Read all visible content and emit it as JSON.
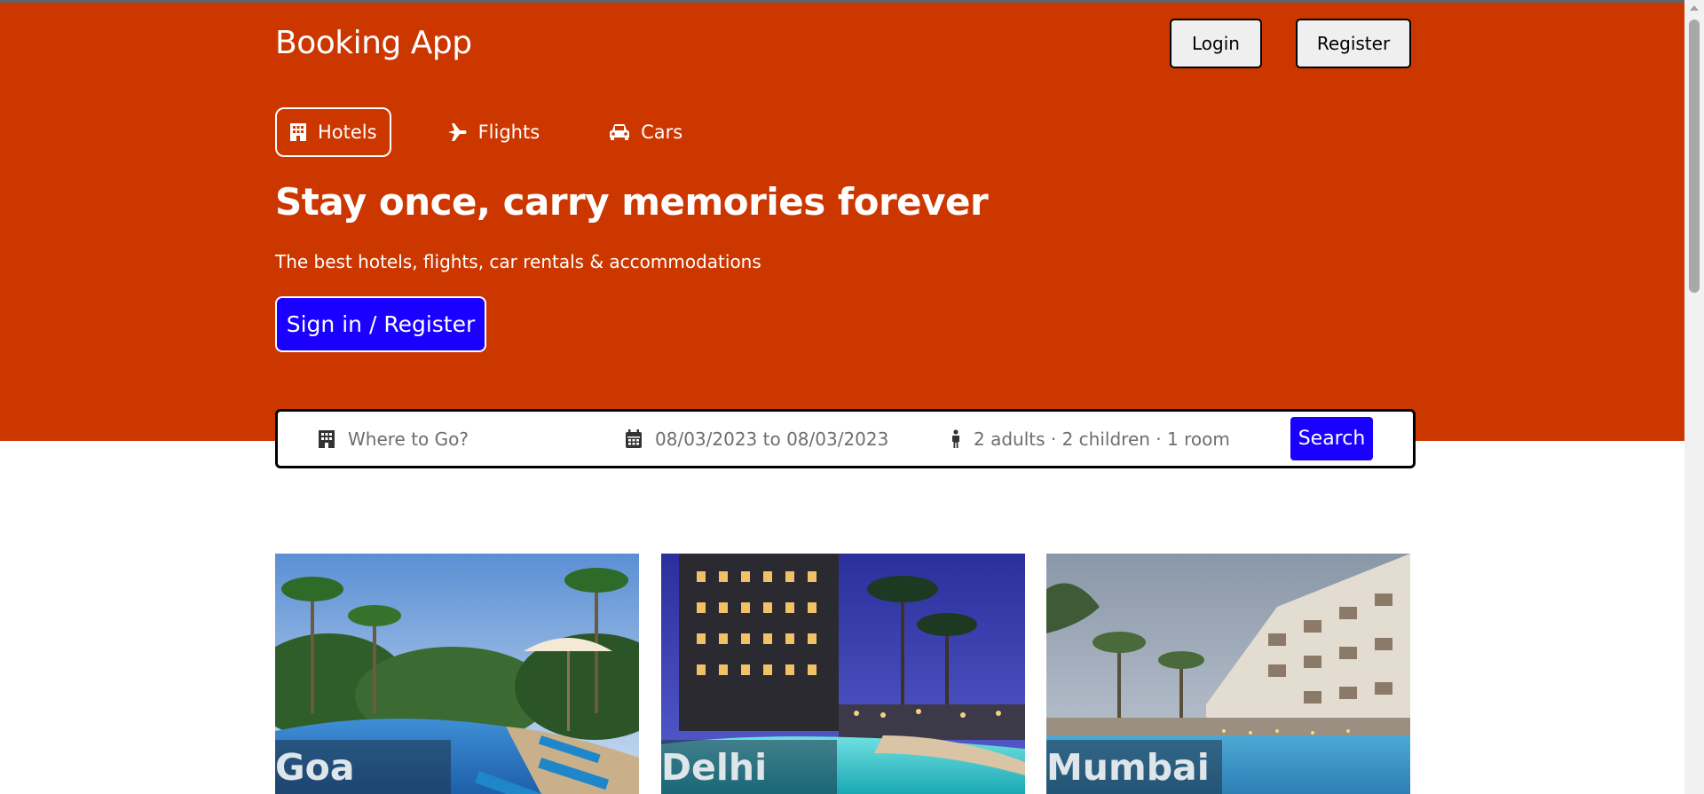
{
  "header": {
    "brand": "Booking App",
    "login_label": "Login",
    "register_label": "Register"
  },
  "tabs": [
    {
      "label": "Hotels",
      "icon": "hotel-icon",
      "active": true
    },
    {
      "label": "Flights",
      "icon": "plane-icon",
      "active": false
    },
    {
      "label": "Cars",
      "icon": "car-icon",
      "active": false
    }
  ],
  "hero": {
    "headline": "Stay once, carry memories forever",
    "subline": "The best hotels, flights, car rentals & accommodations",
    "cta_label": "Sign in / Register",
    "background_color": "#cc3700",
    "accent_color": "#1a00ff"
  },
  "search": {
    "destination_placeholder": "Where to Go?",
    "dates_value": "08/03/2023 to 08/03/2023",
    "guests_value": "2 adults · 2 children · 1 room",
    "button_label": "Search"
  },
  "destinations": [
    {
      "name": "Goa"
    },
    {
      "name": "Delhi"
    },
    {
      "name": "Mumbai"
    }
  ]
}
